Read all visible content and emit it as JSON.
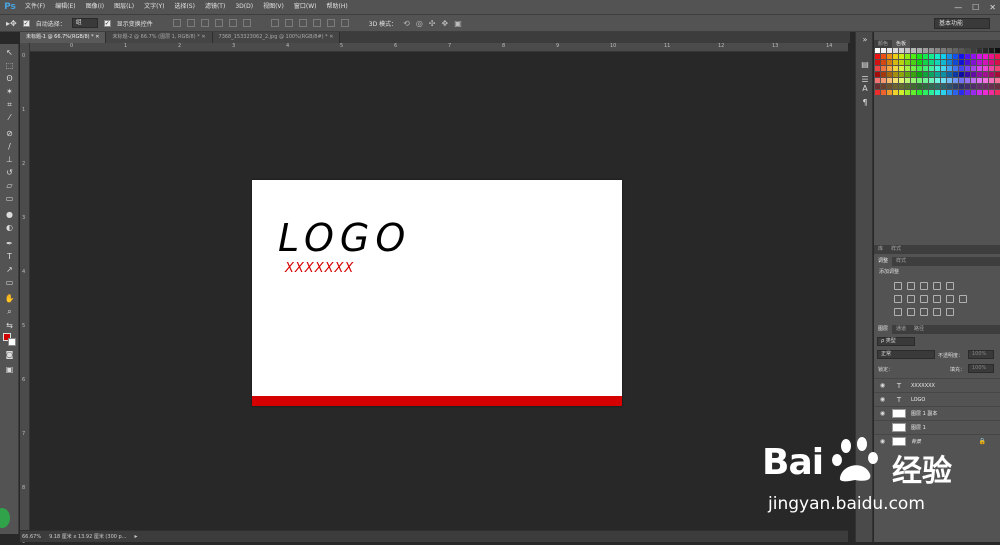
{
  "app": {
    "logo": "Ps"
  },
  "menu": [
    "文件(F)",
    "编辑(E)",
    "图像(I)",
    "图层(L)",
    "文字(Y)",
    "选择(S)",
    "滤镜(T)",
    "3D(D)",
    "视图(V)",
    "窗口(W)",
    "帮助(H)"
  ],
  "window_controls": [
    "—",
    "☐",
    "✕"
  ],
  "options_bar": {
    "auto_select_label": "自动选择：",
    "auto_select_value": "组",
    "show_transform_label": "显示变换控件",
    "mode_3d_label": "3D 模式：",
    "workspace": "基本功能"
  },
  "tabs": [
    {
      "label": "未标题-1 @ 66.7%(RGB/8) *",
      "close": "✕"
    },
    {
      "label": "未标题-2 @ 66.7% (图层 1, RGB/8) *",
      "close": "✕"
    },
    {
      "label": "7368_153323062_2.jpg @ 100%(RGB/8#) *",
      "close": "✕"
    }
  ],
  "ruler_top": [
    "0",
    "1",
    "2",
    "3",
    "4",
    "5",
    "6",
    "7",
    "8",
    "9",
    "10",
    "11",
    "12",
    "13",
    "14"
  ],
  "ruler_left": [
    "0",
    "1",
    "2",
    "3",
    "4",
    "5",
    "6",
    "7",
    "8",
    "9"
  ],
  "canvas": {
    "logo_text": "LOGO",
    "sub_text": "XXXXXXX",
    "bar_color": "#d50000",
    "logo_color": "#000000",
    "sub_color": "#d40000"
  },
  "status": {
    "zoom": "66.67%",
    "doc_size": "9.18 厘米 x 13.92 厘米 (300 p..."
  },
  "panels": {
    "swatch_tabs": [
      "颜色",
      "色板"
    ],
    "style_tabs": [
      "库",
      "样式"
    ],
    "adjust_tabs": [
      "调整",
      "样式"
    ],
    "adjust_title": "添加调整",
    "layers_tabs": [
      "图层",
      "通道",
      "路径"
    ],
    "filter_kind": "ρ 类型",
    "blend_mode": "正常",
    "opacity_label": "不透明度：",
    "opacity_value": "100%",
    "lock_label": "锁定：",
    "fill_label": "填充：",
    "fill_value": "100%",
    "layers": [
      {
        "name": "XXXXXXX",
        "kind": "text",
        "visible": true
      },
      {
        "name": "LOGO",
        "kind": "text",
        "visible": true
      },
      {
        "name": "图层 1 副本",
        "kind": "pixel",
        "visible": true
      },
      {
        "name": "图层 1",
        "kind": "pixel",
        "visible": false
      },
      {
        "name": "背景",
        "kind": "background",
        "visible": true
      }
    ]
  },
  "watermark": {
    "brand": "Bai",
    "cn": "经验",
    "url": "jingyan.baidu.com"
  }
}
